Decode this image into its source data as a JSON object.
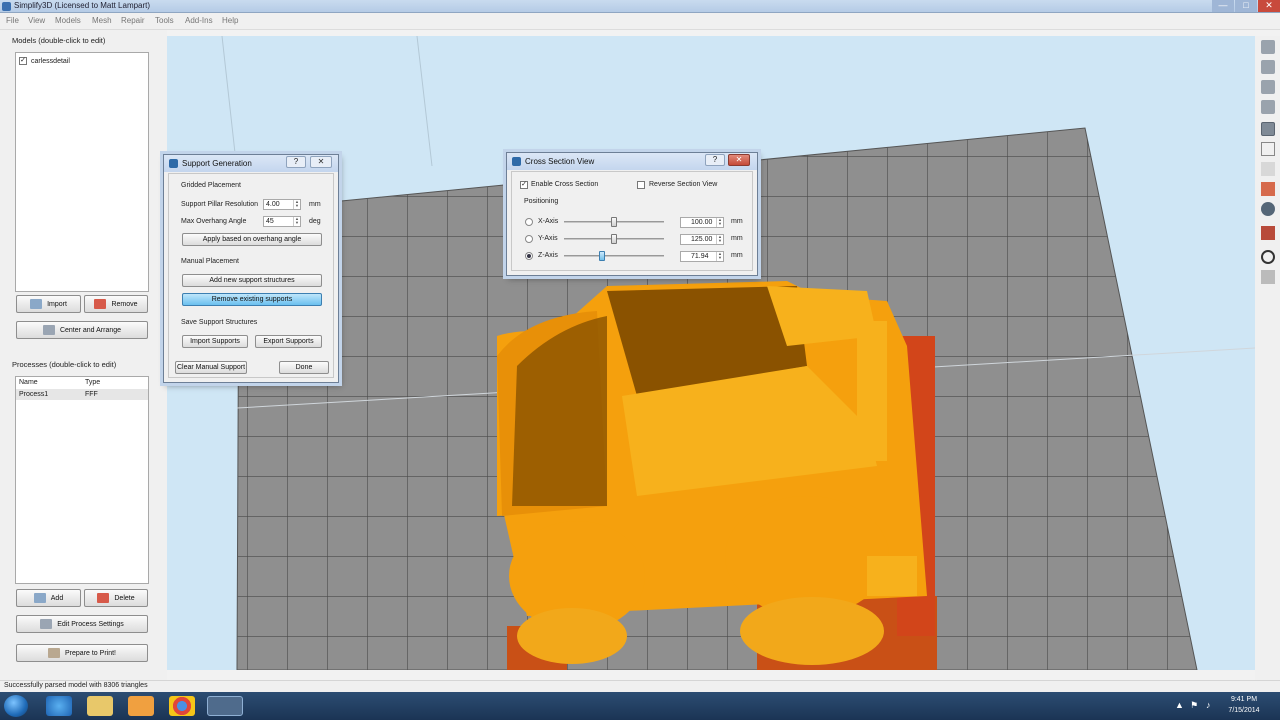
{
  "window": {
    "title": "Simplify3D (Licensed to Matt Lampart)",
    "min_label": "—",
    "max_label": "□",
    "close_label": "✕"
  },
  "menu": [
    "File",
    "View",
    "Models",
    "Mesh",
    "Repair",
    "Tools",
    "Add-Ins",
    "Help"
  ],
  "models": {
    "label": "Models (double-click to edit)",
    "items": [
      {
        "name": "carlessdetail",
        "checked": "✓"
      }
    ],
    "import_label": "Import",
    "remove_label": "Remove",
    "center_label": "Center and Arrange"
  },
  "processes": {
    "label": "Processes (double-click to edit)",
    "col_name": "Name",
    "col_type": "Type",
    "rows": [
      {
        "name": "Process1",
        "type": "FFF"
      }
    ],
    "add_label": "Add",
    "delete_label": "Delete",
    "edit_label": "Edit Process Settings",
    "prepare_label": "Prepare to Print!"
  },
  "status": {
    "text": "Successfully parsed model with 8306 triangles"
  },
  "support_dialog": {
    "title": "Support Generation",
    "help_label": "?",
    "close_label": "✕",
    "gridded_label": "Gridded Placement",
    "pillar_label": "Support Pillar Resolution",
    "pillar_value": "4.00",
    "pillar_unit": "mm",
    "overhang_label": "Max Overhang Angle",
    "overhang_value": "45",
    "overhang_unit": "deg",
    "apply_label": "Apply based on overhang angle",
    "manual_label": "Manual Placement",
    "add_new_label": "Add new support structures",
    "remove_existing_label": "Remove existing supports",
    "save_label": "Save Support Structures",
    "import_label": "Import Supports",
    "export_label": "Export Supports",
    "clear_label": "Clear Manual Support",
    "done_label": "Done"
  },
  "cross_section": {
    "title": "Cross Section View",
    "help_label": "?",
    "close_label": "✕",
    "enable_label": "Enable Cross Section",
    "enable_checked": "✓",
    "reverse_label": "Reverse Section View",
    "positioning_label": "Positioning",
    "axes": [
      {
        "label": "X-Axis",
        "value": "100.00",
        "unit": "mm",
        "selected": false,
        "level": 0.5
      },
      {
        "label": "Y-Axis",
        "value": "125.00",
        "unit": "mm",
        "selected": false,
        "level": 0.5
      },
      {
        "label": "Z-Axis",
        "value": "71.94",
        "unit": "mm",
        "selected": true,
        "level": 0.38
      }
    ]
  },
  "taskbar": {
    "time": "9:41 PM",
    "date": "7/15/2014",
    "apps": [
      "ie-icon",
      "folder-icon",
      "media-player-icon",
      "chrome-icon",
      "simplify3d-icon"
    ]
  },
  "colors": {
    "part_orange": "#f5a00d",
    "part_dark": "#8a5200",
    "support_red": "#d2451a",
    "bed_gray": "#8f8f8f",
    "sky_blue": "#cfe6f5",
    "active_blue": "#6bc0ef"
  }
}
